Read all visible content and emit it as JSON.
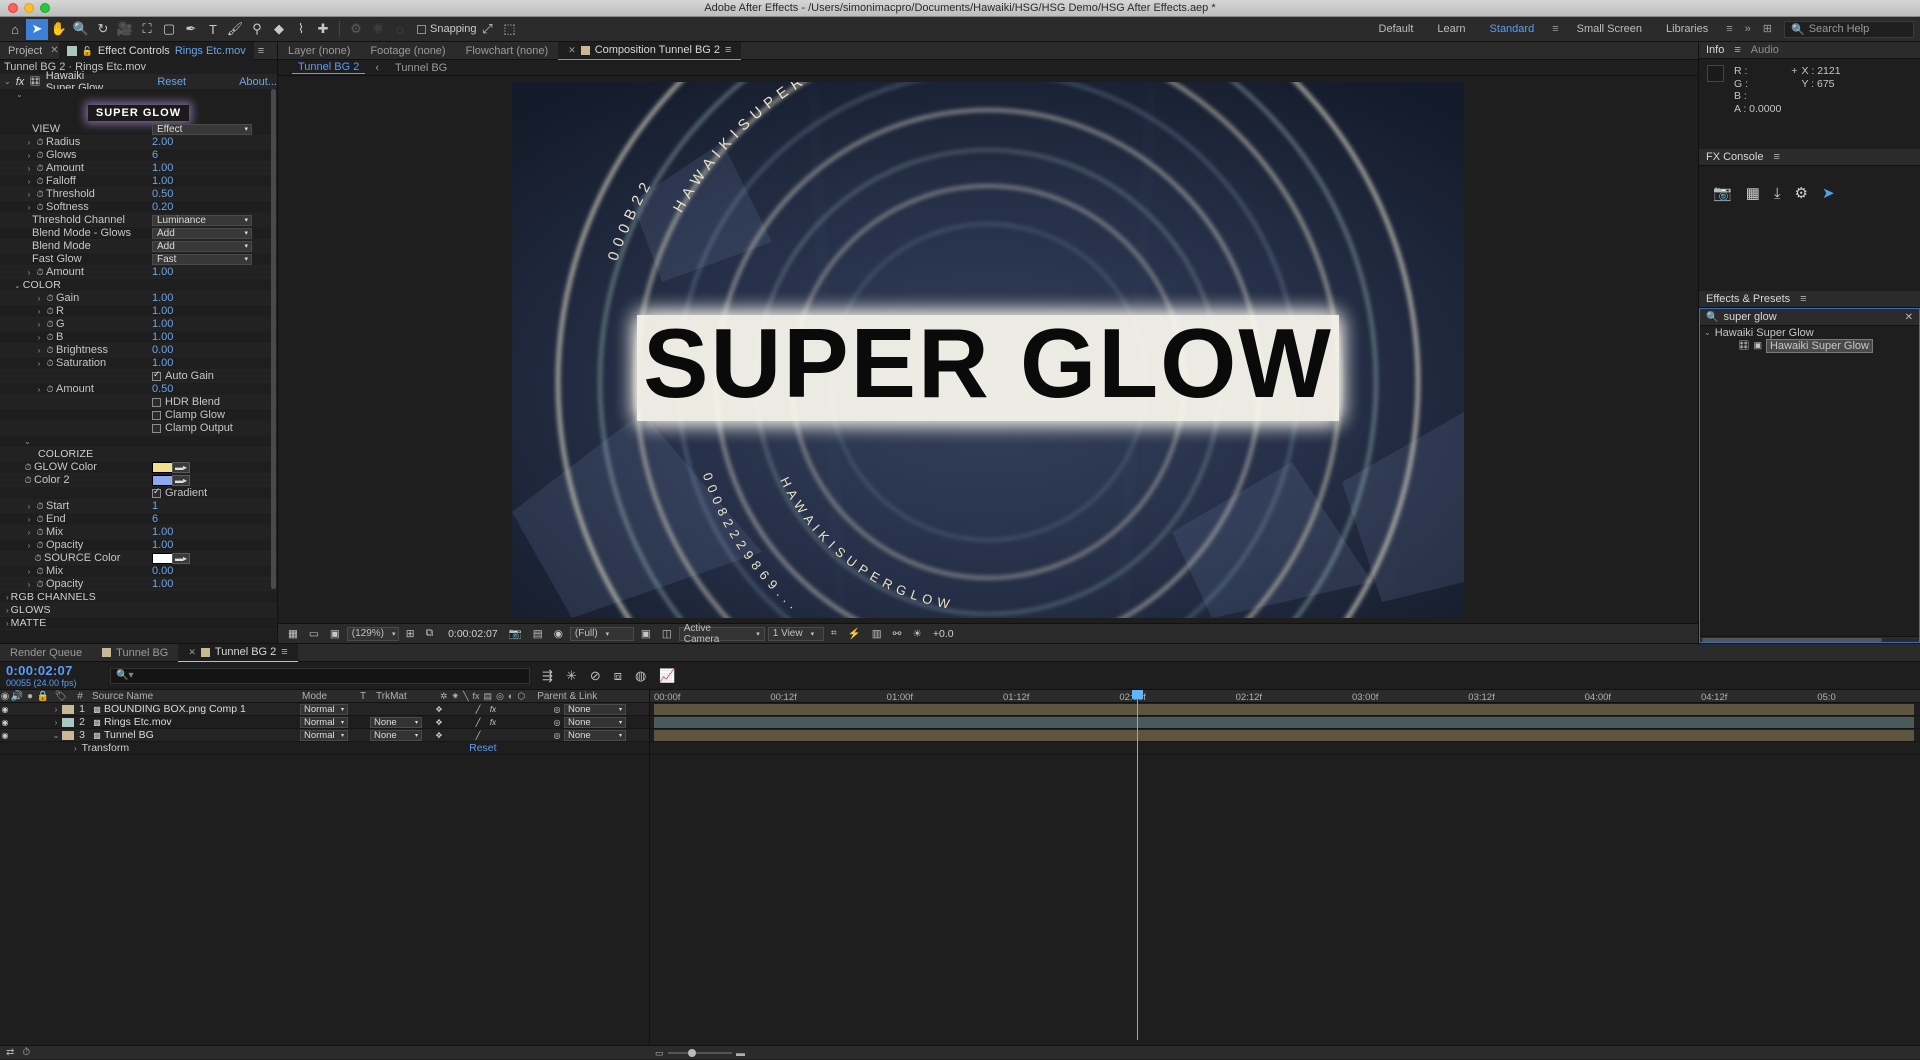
{
  "window": {
    "title": "Adobe After Effects - /Users/simonimacpro/Documents/Hawaiki/HSG/HSG Demo/HSG After Effects.aep *"
  },
  "toolbar": {
    "tools": [
      {
        "name": "home-icon",
        "glyph": "⌂",
        "selected": false
      },
      {
        "name": "selection-tool-icon",
        "glyph": "➤",
        "selected": true
      },
      {
        "name": "hand-tool-icon",
        "glyph": "✋",
        "selected": false
      },
      {
        "name": "zoom-tool-icon",
        "glyph": "🔍",
        "selected": false
      },
      {
        "name": "rotation-tool-icon",
        "glyph": "↻",
        "selected": false
      },
      {
        "name": "camera-tool-icon",
        "glyph": "🎥",
        "selected": false
      },
      {
        "name": "anchor-point-tool-icon",
        "glyph": "⛶",
        "selected": false
      },
      {
        "name": "shape-tool-icon",
        "glyph": "▢",
        "selected": false
      },
      {
        "name": "pen-tool-icon",
        "glyph": "✒",
        "selected": false
      },
      {
        "name": "type-tool-icon",
        "glyph": "T",
        "selected": false
      },
      {
        "name": "brush-tool-icon",
        "glyph": "🖌",
        "selected": false
      },
      {
        "name": "clone-stamp-tool-icon",
        "glyph": "⚲",
        "selected": false
      },
      {
        "name": "eraser-tool-icon",
        "glyph": "◆",
        "selected": false
      },
      {
        "name": "roto-brush-tool-icon",
        "glyph": "⌇",
        "selected": false
      },
      {
        "name": "puppet-pin-tool-icon",
        "glyph": "✚",
        "selected": false
      }
    ],
    "dim_tools": [
      {
        "name": "puppet-starch-icon",
        "glyph": "⚙"
      },
      {
        "name": "puppet-overlap-icon",
        "glyph": "⚛"
      },
      {
        "name": "puppet-bend-icon",
        "glyph": "◌"
      }
    ],
    "snapping_label": "Snapping",
    "snapping_checked": false,
    "right_icons": [
      {
        "name": "snapping-arrow-icon",
        "glyph": "⤢"
      },
      {
        "name": "snapping-grid-icon",
        "glyph": "⬚"
      }
    ]
  },
  "workspaces": {
    "items": [
      {
        "label": "Default",
        "active": false
      },
      {
        "label": "Learn",
        "active": false
      },
      {
        "label": "Standard",
        "active": true
      },
      {
        "label": "Small Screen",
        "active": false
      },
      {
        "label": "Libraries",
        "active": false
      }
    ],
    "menu_glyph": "≡",
    "overflow_glyph": "»",
    "grid_glyph": "⊞",
    "search_placeholder": "Search Help",
    "search_icon": "search-icon"
  },
  "effect_controls": {
    "tabs": [
      {
        "label": "Project",
        "active": false,
        "closable": true
      },
      {
        "label": "Effect Controls",
        "value": "Rings Etc.mov",
        "active": true
      }
    ],
    "menu_glyph": "≡",
    "lock_glyph": "🔒",
    "subheader": "Tunnel BG 2 · Rings Etc.mov",
    "effect_name": "Hawaiki Super Glow",
    "reset_label": "Reset",
    "about_label": "About...",
    "fx_glyph": "fx",
    "badge_label": "SUPER GLOW",
    "rows": [
      {
        "type": "select",
        "label": "VIEW",
        "value": "Effect",
        "indent": 1
      },
      {
        "type": "num",
        "label": "Radius",
        "value": "2.00",
        "indent": 1,
        "anim": true
      },
      {
        "type": "num",
        "label": "Glows",
        "value": "6",
        "indent": 1,
        "anim": true
      },
      {
        "type": "num",
        "label": "Amount",
        "value": "1.00",
        "indent": 1,
        "anim": true
      },
      {
        "type": "num",
        "label": "Falloff",
        "value": "1.00",
        "indent": 1,
        "anim": true
      },
      {
        "type": "num",
        "label": "Threshold",
        "value": "0.50",
        "indent": 1,
        "anim": true
      },
      {
        "type": "num",
        "label": "Softness",
        "value": "0.20",
        "indent": 1,
        "anim": true
      },
      {
        "type": "select",
        "label": "Threshold Channel",
        "value": "Luminance",
        "indent": 1
      },
      {
        "type": "select",
        "label": "Blend Mode - Glows",
        "value": "Add",
        "indent": 1
      },
      {
        "type": "select",
        "label": "Blend Mode",
        "value": "Add",
        "indent": 1
      },
      {
        "type": "select",
        "label": "Fast Glow",
        "value": "Fast",
        "indent": 1
      },
      {
        "type": "num",
        "label": "Amount",
        "value": "1.00",
        "indent": 1,
        "anim": true
      },
      {
        "type": "group",
        "label": "COLOR",
        "indent": 1,
        "open": true
      },
      {
        "type": "num",
        "label": "Gain",
        "value": "1.00",
        "indent": 2,
        "anim": true
      },
      {
        "type": "num",
        "label": "R",
        "value": "1.00",
        "indent": 2,
        "anim": true
      },
      {
        "type": "num",
        "label": "G",
        "value": "1.00",
        "indent": 2,
        "anim": true
      },
      {
        "type": "num",
        "label": "B",
        "value": "1.00",
        "indent": 2,
        "anim": true
      },
      {
        "type": "num",
        "label": "Brightness",
        "value": "0.00",
        "indent": 2,
        "anim": true
      },
      {
        "type": "num",
        "label": "Saturation",
        "value": "1.00",
        "indent": 2,
        "anim": true
      },
      {
        "type": "check",
        "label": "Auto Gain",
        "checked": true
      },
      {
        "type": "num",
        "label": "Amount",
        "value": "0.50",
        "indent": 2,
        "anim": true
      },
      {
        "type": "check",
        "label": "HDR Blend",
        "checked": false
      },
      {
        "type": "check",
        "label": "Clamp Glow",
        "checked": false
      },
      {
        "type": "check",
        "label": "Clamp Output",
        "checked": false
      },
      {
        "type": "caret",
        "label": ""
      },
      {
        "type": "header",
        "label": "COLORIZE"
      },
      {
        "type": "color",
        "label": "GLOW Color",
        "color": "#f3e08a",
        "anim": true
      },
      {
        "type": "color",
        "label": "Color 2",
        "color": "#8fa9f0",
        "anim": true
      },
      {
        "type": "check",
        "label": "Gradient",
        "checked": true
      },
      {
        "type": "num",
        "label": "Start",
        "value": "1",
        "indent": 1,
        "anim": true
      },
      {
        "type": "num",
        "label": "End",
        "value": "6",
        "indent": 1,
        "anim": true
      },
      {
        "type": "num",
        "label": "Mix",
        "value": "1.00",
        "indent": 1,
        "anim": true
      },
      {
        "type": "num",
        "label": "Opacity",
        "value": "1.00",
        "indent": 1,
        "anim": true
      },
      {
        "type": "color",
        "label": "SOURCE Color",
        "color": "#ffffff",
        "anim": true,
        "indent": 1
      },
      {
        "type": "num",
        "label": "Mix",
        "value": "0.00",
        "indent": 1,
        "anim": true
      },
      {
        "type": "num",
        "label": "Opacity",
        "value": "1.00",
        "indent": 1,
        "anim": true
      },
      {
        "type": "group",
        "label": "RGB CHANNELS",
        "indent": 0,
        "open": false
      },
      {
        "type": "group",
        "label": "GLOWS",
        "indent": 0,
        "open": false
      },
      {
        "type": "group",
        "label": "MATTE",
        "indent": 0,
        "open": false
      }
    ]
  },
  "composition": {
    "tabs": [
      {
        "label": "Layer (none)",
        "active": false
      },
      {
        "label": "Footage (none)",
        "active": false
      },
      {
        "label": "Flowchart (none)",
        "active": false
      },
      {
        "label": "Composition Tunnel BG 2",
        "active": true
      }
    ],
    "menu_glyph": "≡",
    "subtabs": [
      {
        "label": "Tunnel BG 2",
        "active": true
      },
      {
        "label": "Tunnel BG",
        "active": false
      }
    ],
    "subtab_sep": "‹",
    "headline": "SUPER GLOW",
    "ring_text_top": "H A W A I K I   S U P E R   G L O W",
    "ring_text_bottom": "H A W A I K I   S U P E R   G L O W",
    "footer": {
      "zoom": "(129%)",
      "timecode": "0:00:02:07",
      "resolution": "(Full)",
      "camera": "Active Camera",
      "views": "1 View",
      "exposure": "+0.0",
      "icons": [
        {
          "name": "toggle-transparency-grid-icon",
          "glyph": "▦"
        },
        {
          "name": "toggle-mask-paths-icon",
          "glyph": "▭"
        },
        {
          "name": "toggle-snapshot-icon",
          "glyph": "▣"
        },
        {
          "name": "show-snapshot-icon",
          "glyph": "▤"
        },
        {
          "name": "channel-icon",
          "glyph": "◉"
        },
        {
          "name": "region-of-interest-icon",
          "glyph": "⧉"
        },
        {
          "name": "take-snapshot-icon",
          "glyph": "📷"
        },
        {
          "name": "grid-guides-icon",
          "glyph": "⊞"
        },
        {
          "name": "3d-renderer-icon",
          "glyph": "◫"
        },
        {
          "name": "fast-previews-icon",
          "glyph": "⚡"
        },
        {
          "name": "timeline-icon",
          "glyph": "▥"
        },
        {
          "name": "comp-flowchart-icon",
          "glyph": "⚯"
        },
        {
          "name": "reset-exposure-icon",
          "glyph": "☀"
        }
      ]
    }
  },
  "info_panel": {
    "tabs": [
      {
        "label": "Info",
        "active": true
      },
      {
        "label": "Audio",
        "active": false
      }
    ],
    "menu_glyph": "≡",
    "channels": [
      {
        "label": "R :",
        "value": ""
      },
      {
        "label": "G :",
        "value": ""
      },
      {
        "label": "B :",
        "value": ""
      },
      {
        "label": "A :",
        "value": "0.0000"
      }
    ],
    "coords": [
      {
        "label": "X :",
        "value": "2121"
      },
      {
        "label": "Y :",
        "value": "675"
      }
    ],
    "plus_glyph": "+"
  },
  "fx_console": {
    "title": "FX Console",
    "menu_glyph": "≡",
    "icons": [
      {
        "name": "screenshot-icon",
        "glyph": "📷"
      },
      {
        "name": "contact-sheet-icon",
        "glyph": "▦"
      },
      {
        "name": "download-icon",
        "glyph": "⤓"
      },
      {
        "name": "settings-gear-icon",
        "glyph": "⚙"
      },
      {
        "name": "send-icon",
        "glyph": "➤"
      }
    ]
  },
  "effects_presets": {
    "title": "Effects & Presets",
    "menu_glyph": "≡",
    "search_value": "super glow",
    "search_icon": "search-icon",
    "clear_glyph": "✕",
    "tree": [
      {
        "label": "Hawaiki Super Glow",
        "type": "folder",
        "open": true,
        "selected": false
      },
      {
        "label": "Hawaiki Super Glow",
        "type": "effect",
        "selected": true
      }
    ]
  },
  "timeline": {
    "tabs": [
      {
        "label": "Render Queue",
        "active": false,
        "swatch": false
      },
      {
        "label": "Tunnel BG",
        "active": false,
        "swatch": true
      },
      {
        "label": "Tunnel BG 2",
        "active": true,
        "swatch": true,
        "closable": true
      }
    ],
    "menu_glyph": "≡",
    "current_time": "0:00:02:07",
    "frame_info": "00055 (24.00 fps)",
    "search_placeholder": "",
    "search_icon": "search-icon",
    "control_icons": [
      {
        "name": "comp-mini-flowchart-icon",
        "glyph": "⇶"
      },
      {
        "name": "draft-3d-icon",
        "glyph": "✳"
      },
      {
        "name": "hide-shy-layers-icon",
        "glyph": "⊘"
      },
      {
        "name": "frame-blending-icon",
        "glyph": "⧈"
      },
      {
        "name": "motion-blur-icon",
        "glyph": "◍"
      },
      {
        "name": "graph-editor-icon",
        "glyph": "📈"
      }
    ],
    "columns": [
      {
        "label": "",
        "name": "video-toggle-col"
      },
      {
        "label": "#",
        "name": "index-col"
      },
      {
        "label": "Source Name",
        "name": "source-name-col"
      },
      {
        "label": "Mode",
        "name": "mode-col"
      },
      {
        "label": "T",
        "name": "t-col"
      },
      {
        "label": "TrkMat",
        "name": "trkmat-col"
      },
      {
        "label": "Parent & Link",
        "name": "parent-link-col"
      }
    ],
    "header_icons": [
      {
        "name": "eye-icon",
        "glyph": "◉"
      },
      {
        "name": "audio-icon",
        "glyph": "🔊"
      },
      {
        "name": "solo-icon",
        "glyph": "●"
      },
      {
        "name": "lock-icon",
        "glyph": "🔒"
      },
      {
        "name": "label-icon",
        "glyph": "🏷"
      }
    ],
    "switch_icons": [
      {
        "name": "shy-icon",
        "glyph": "✲"
      },
      {
        "name": "collapse-icon",
        "glyph": "✷"
      },
      {
        "name": "quality-icon",
        "glyph": "╲"
      },
      {
        "name": "effects-icon",
        "glyph": "fx"
      },
      {
        "name": "frame-blend-icon",
        "glyph": "▤"
      },
      {
        "name": "motion-blur-switch-icon",
        "glyph": "◎"
      },
      {
        "name": "adjustment-icon",
        "glyph": "◐"
      },
      {
        "name": "3d-layer-icon",
        "glyph": "⬡"
      }
    ],
    "layers": [
      {
        "index": "1",
        "name": "BOUNDING BOX.png Comp 1",
        "mode": "Normal",
        "trkmat": "",
        "parent": "None",
        "label_color": "#c9b896",
        "icon": "comp-icon",
        "has_fx": true,
        "expanded": false,
        "bar_color": "#5d5540"
      },
      {
        "index": "2",
        "name": "Rings Etc.mov",
        "mode": "Normal",
        "trkmat": "None",
        "parent": "None",
        "label_color": "#a9c6c0",
        "icon": "footage-icon",
        "has_fx": true,
        "expanded": false,
        "bar_color": "#4a5a5a"
      },
      {
        "index": "3",
        "name": "Tunnel BG",
        "mode": "Normal",
        "trkmat": "None",
        "parent": "None",
        "label_color": "#c9b896",
        "icon": "comp-icon",
        "has_fx": false,
        "expanded": true,
        "bar_color": "#5d5540"
      }
    ],
    "transform_label": "Transform",
    "reset_label": "Reset",
    "ruler_ticks": [
      "00:00f",
      "00:12f",
      "01:00f",
      "01:12f",
      "02:00f",
      "02:12f",
      "03:00f",
      "03:12f",
      "04:00f",
      "04:12f",
      "05:0"
    ],
    "footer_icons": [
      {
        "name": "toggle-switches-modes-icon",
        "glyph": "⇄"
      },
      {
        "name": "frame-render-time-icon",
        "glyph": "⏱"
      },
      {
        "name": "zoom-out-icon",
        "glyph": "▭"
      },
      {
        "name": "zoom-in-icon",
        "glyph": "▬"
      }
    ]
  },
  "colors": {
    "accent_blue": "#5a9cf8",
    "value_blue": "#6aa5e8",
    "panel_bg": "#1e1e1e",
    "header_bg": "#2b2b2b",
    "glow_color": "#f3e08a",
    "color2": "#8fa9f0",
    "selection": "#3c7fd6"
  }
}
